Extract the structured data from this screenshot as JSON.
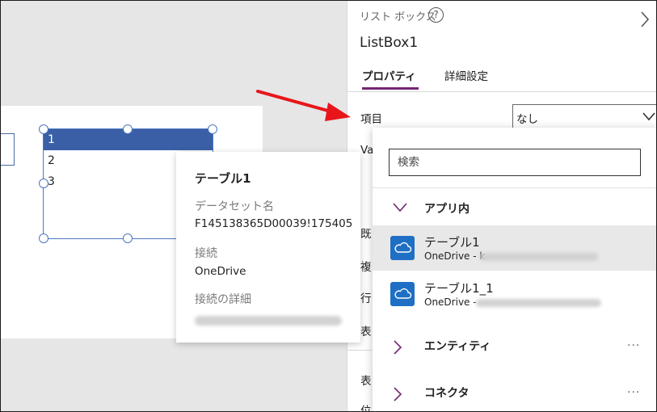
{
  "canvas": {
    "listbox_items": [
      "1",
      "2",
      "3"
    ]
  },
  "tooltip": {
    "title": "テーブル1",
    "dataset_label": "データセット名",
    "dataset_value": "F145138365D00039!175405",
    "connection_label": "接続",
    "connection_value": "OneDrive",
    "connection_details_label": "接続の詳細"
  },
  "panel": {
    "control_type": "リスト ボックス",
    "help_glyph": "?",
    "control_name": "ListBox1",
    "tabs": [
      {
        "label": "プロパティ",
        "active": true
      },
      {
        "label": "詳細設定",
        "active": false
      }
    ],
    "items_label": "項目",
    "items_value": "なし",
    "partial_labels": [
      "Va",
      "既",
      "複",
      "行",
      "表",
      "表",
      "位"
    ]
  },
  "dropdown": {
    "search_placeholder": "検索",
    "groups": {
      "in_app": "アプリ内",
      "entities": "エンティティ",
      "connectors": "コネクタ",
      "more": "..."
    },
    "datasources": [
      {
        "name": "テーブル1",
        "sub": "OneDrive - k",
        "highlighted": true
      },
      {
        "name": "テーブル1_1",
        "sub": "OneDrive - ",
        "highlighted": false
      }
    ]
  },
  "colors": {
    "accent_purple": "#742774",
    "onedrive_blue": "#1f6fc4",
    "selection_blue": "#3a5fa6",
    "arrow_red": "#e8161b"
  }
}
